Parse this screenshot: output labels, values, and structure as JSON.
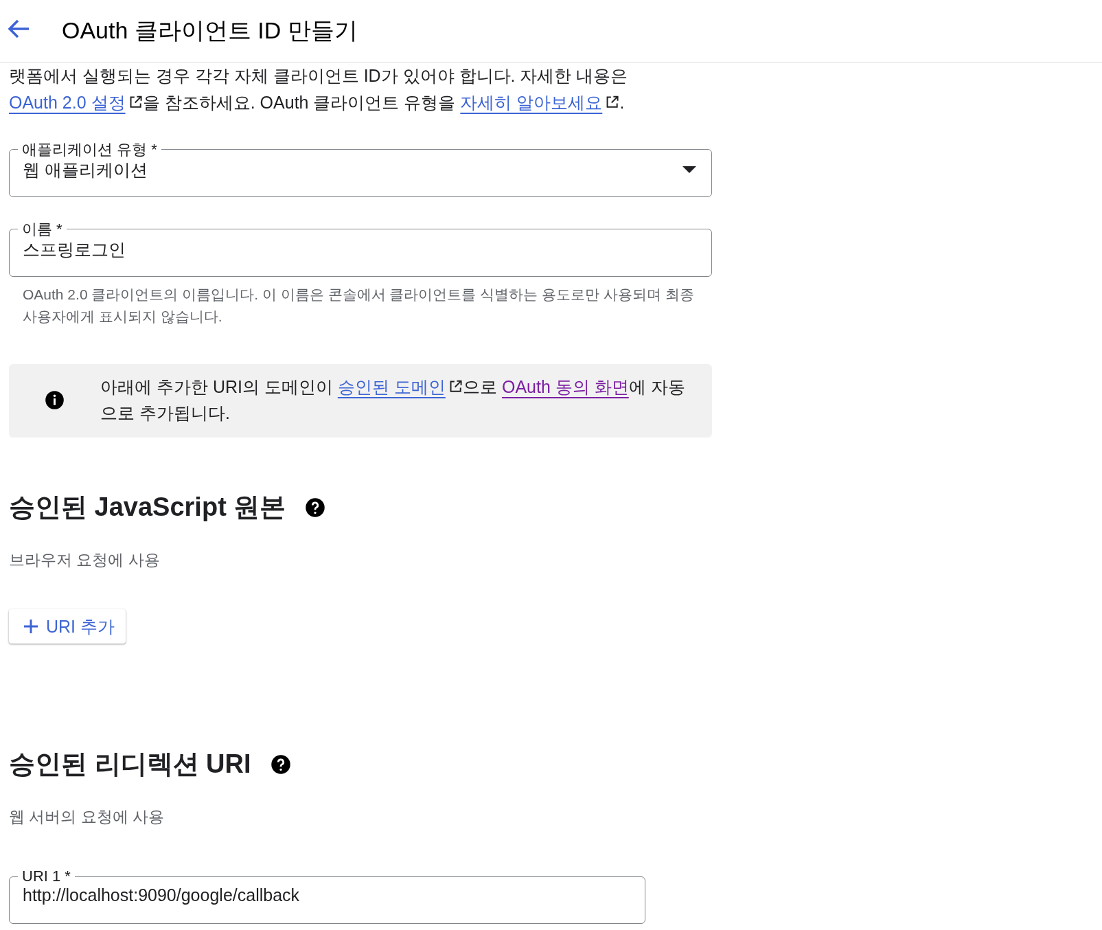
{
  "header": {
    "title": "OAuth 클라이언트 ID 만들기"
  },
  "intro": [
    {
      "kind": "text",
      "text": "랫폼에서 실행되는 경우 각각 자체 클라이언트 ID가 있어야 합니다. 자세한 내용은 "
    },
    {
      "kind": "link",
      "text": "OAuth 2.0 설정",
      "external": true,
      "visited": false
    },
    {
      "kind": "text",
      "text": "을 참조하세요. OAuth 클라이언트 유형을 "
    },
    {
      "kind": "link",
      "text": "자세히 알아보세요",
      "external": true,
      "visited": false
    },
    {
      "kind": "text",
      "text": "."
    }
  ],
  "app_type": {
    "label": "애플리케이션 유형 *",
    "value": "웹 애플리케이션"
  },
  "name": {
    "label": "이름 *",
    "value": "스프링로그인",
    "helper": "OAuth 2.0 클라이언트의 이름입니다. 이 이름은 콘솔에서 클라이언트를 식별하는 용도로만 사용되며 최종 사용자에게 표시되지 않습니다."
  },
  "notice": [
    {
      "kind": "text",
      "text": "아래에 추가한 URI의 도메인이 "
    },
    {
      "kind": "link",
      "text": "승인된 도메인",
      "external": true,
      "visited": false
    },
    {
      "kind": "text",
      "text": "으로 "
    },
    {
      "kind": "link",
      "text": "OAuth 동의 화면",
      "external": false,
      "visited": true
    },
    {
      "kind": "text",
      "text": "에 자동으로 추가됩니다."
    }
  ],
  "js_origins": {
    "title": "승인된 JavaScript 원본",
    "subtitle": "브라우저 요청에 사용",
    "add_button": "URI 추가"
  },
  "redirects": {
    "title": "승인된 리디렉션 URI",
    "subtitle": "웹 서버의 요청에 사용",
    "uris": [
      {
        "label": "URI 1 *",
        "value": "http://localhost:9090/google/callback"
      }
    ]
  }
}
